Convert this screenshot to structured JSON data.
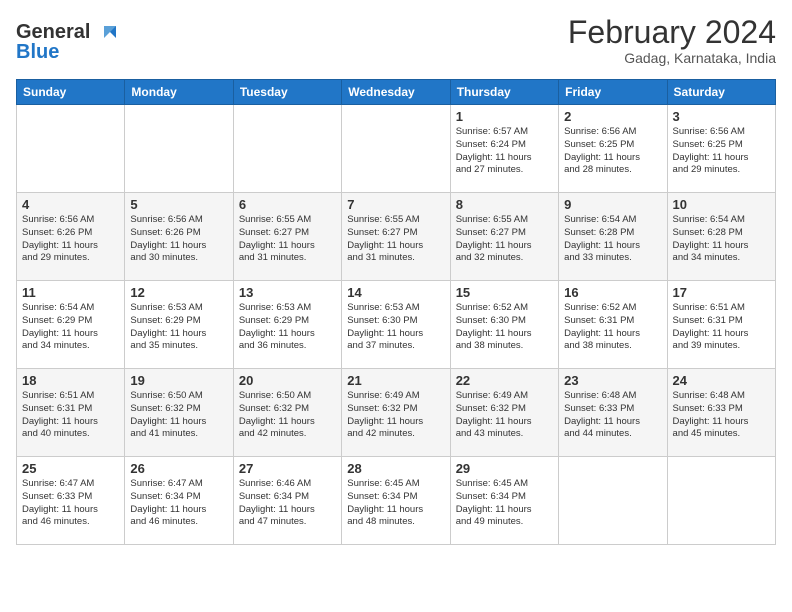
{
  "logo": {
    "line1": "General",
    "line2": "Blue"
  },
  "title": "February 2024",
  "location": "Gadag, Karnataka, India",
  "days_of_week": [
    "Sunday",
    "Monday",
    "Tuesday",
    "Wednesday",
    "Thursday",
    "Friday",
    "Saturday"
  ],
  "weeks": [
    [
      {
        "date": "",
        "info": ""
      },
      {
        "date": "",
        "info": ""
      },
      {
        "date": "",
        "info": ""
      },
      {
        "date": "",
        "info": ""
      },
      {
        "date": "1",
        "info": "Sunrise: 6:57 AM\nSunset: 6:24 PM\nDaylight: 11 hours\nand 27 minutes."
      },
      {
        "date": "2",
        "info": "Sunrise: 6:56 AM\nSunset: 6:25 PM\nDaylight: 11 hours\nand 28 minutes."
      },
      {
        "date": "3",
        "info": "Sunrise: 6:56 AM\nSunset: 6:25 PM\nDaylight: 11 hours\nand 29 minutes."
      }
    ],
    [
      {
        "date": "4",
        "info": "Sunrise: 6:56 AM\nSunset: 6:26 PM\nDaylight: 11 hours\nand 29 minutes."
      },
      {
        "date": "5",
        "info": "Sunrise: 6:56 AM\nSunset: 6:26 PM\nDaylight: 11 hours\nand 30 minutes."
      },
      {
        "date": "6",
        "info": "Sunrise: 6:55 AM\nSunset: 6:27 PM\nDaylight: 11 hours\nand 31 minutes."
      },
      {
        "date": "7",
        "info": "Sunrise: 6:55 AM\nSunset: 6:27 PM\nDaylight: 11 hours\nand 31 minutes."
      },
      {
        "date": "8",
        "info": "Sunrise: 6:55 AM\nSunset: 6:27 PM\nDaylight: 11 hours\nand 32 minutes."
      },
      {
        "date": "9",
        "info": "Sunrise: 6:54 AM\nSunset: 6:28 PM\nDaylight: 11 hours\nand 33 minutes."
      },
      {
        "date": "10",
        "info": "Sunrise: 6:54 AM\nSunset: 6:28 PM\nDaylight: 11 hours\nand 34 minutes."
      }
    ],
    [
      {
        "date": "11",
        "info": "Sunrise: 6:54 AM\nSunset: 6:29 PM\nDaylight: 11 hours\nand 34 minutes."
      },
      {
        "date": "12",
        "info": "Sunrise: 6:53 AM\nSunset: 6:29 PM\nDaylight: 11 hours\nand 35 minutes."
      },
      {
        "date": "13",
        "info": "Sunrise: 6:53 AM\nSunset: 6:29 PM\nDaylight: 11 hours\nand 36 minutes."
      },
      {
        "date": "14",
        "info": "Sunrise: 6:53 AM\nSunset: 6:30 PM\nDaylight: 11 hours\nand 37 minutes."
      },
      {
        "date": "15",
        "info": "Sunrise: 6:52 AM\nSunset: 6:30 PM\nDaylight: 11 hours\nand 38 minutes."
      },
      {
        "date": "16",
        "info": "Sunrise: 6:52 AM\nSunset: 6:31 PM\nDaylight: 11 hours\nand 38 minutes."
      },
      {
        "date": "17",
        "info": "Sunrise: 6:51 AM\nSunset: 6:31 PM\nDaylight: 11 hours\nand 39 minutes."
      }
    ],
    [
      {
        "date": "18",
        "info": "Sunrise: 6:51 AM\nSunset: 6:31 PM\nDaylight: 11 hours\nand 40 minutes."
      },
      {
        "date": "19",
        "info": "Sunrise: 6:50 AM\nSunset: 6:32 PM\nDaylight: 11 hours\nand 41 minutes."
      },
      {
        "date": "20",
        "info": "Sunrise: 6:50 AM\nSunset: 6:32 PM\nDaylight: 11 hours\nand 42 minutes."
      },
      {
        "date": "21",
        "info": "Sunrise: 6:49 AM\nSunset: 6:32 PM\nDaylight: 11 hours\nand 42 minutes."
      },
      {
        "date": "22",
        "info": "Sunrise: 6:49 AM\nSunset: 6:32 PM\nDaylight: 11 hours\nand 43 minutes."
      },
      {
        "date": "23",
        "info": "Sunrise: 6:48 AM\nSunset: 6:33 PM\nDaylight: 11 hours\nand 44 minutes."
      },
      {
        "date": "24",
        "info": "Sunrise: 6:48 AM\nSunset: 6:33 PM\nDaylight: 11 hours\nand 45 minutes."
      }
    ],
    [
      {
        "date": "25",
        "info": "Sunrise: 6:47 AM\nSunset: 6:33 PM\nDaylight: 11 hours\nand 46 minutes."
      },
      {
        "date": "26",
        "info": "Sunrise: 6:47 AM\nSunset: 6:34 PM\nDaylight: 11 hours\nand 46 minutes."
      },
      {
        "date": "27",
        "info": "Sunrise: 6:46 AM\nSunset: 6:34 PM\nDaylight: 11 hours\nand 47 minutes."
      },
      {
        "date": "28",
        "info": "Sunrise: 6:45 AM\nSunset: 6:34 PM\nDaylight: 11 hours\nand 48 minutes."
      },
      {
        "date": "29",
        "info": "Sunrise: 6:45 AM\nSunset: 6:34 PM\nDaylight: 11 hours\nand 49 minutes."
      },
      {
        "date": "",
        "info": ""
      },
      {
        "date": "",
        "info": ""
      }
    ]
  ]
}
